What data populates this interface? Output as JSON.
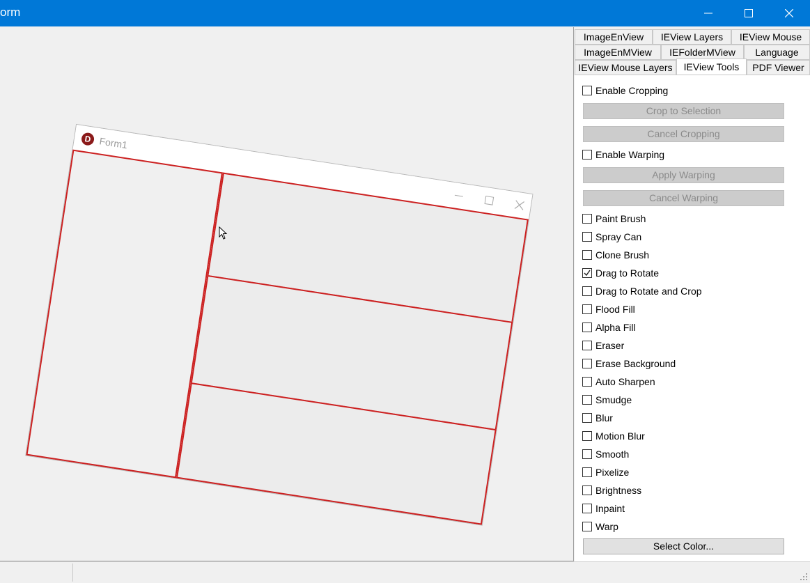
{
  "window": {
    "title": "orm"
  },
  "form_preview": {
    "title": "Form1",
    "icon_letter": "D"
  },
  "tabs": {
    "row1": [
      "ImageEnView",
      "IEView Layers",
      "IEView Mouse"
    ],
    "row2": [
      "ImageEnMView",
      "IEFolderMView",
      "Language"
    ],
    "row3": [
      "IEView Mouse Layers",
      "IEView Tools",
      "PDF Viewer"
    ],
    "active": "IEView Tools"
  },
  "tools": {
    "enable_cropping": {
      "label": "Enable Cropping",
      "checked": false
    },
    "crop_to_selection": "Crop to Selection",
    "cancel_cropping": "Cancel Cropping",
    "enable_warping": {
      "label": "Enable Warping",
      "checked": false
    },
    "apply_warping": "Apply Warping",
    "cancel_warping": "Cancel Warping",
    "options": [
      {
        "label": "Paint Brush",
        "checked": false
      },
      {
        "label": "Spray Can",
        "checked": false
      },
      {
        "label": "Clone Brush",
        "checked": false
      },
      {
        "label": "Drag to Rotate",
        "checked": true
      },
      {
        "label": "Drag to Rotate and Crop",
        "checked": false
      },
      {
        "label": "Flood Fill",
        "checked": false
      },
      {
        "label": "Alpha Fill",
        "checked": false
      },
      {
        "label": "Eraser",
        "checked": false
      },
      {
        "label": "Erase Background",
        "checked": false
      },
      {
        "label": "Auto Sharpen",
        "checked": false
      },
      {
        "label": "Smudge",
        "checked": false
      },
      {
        "label": "Blur",
        "checked": false
      },
      {
        "label": "Motion Blur",
        "checked": false
      },
      {
        "label": "Smooth",
        "checked": false
      },
      {
        "label": "Pixelize",
        "checked": false
      },
      {
        "label": "Brightness",
        "checked": false
      },
      {
        "label": "Inpaint",
        "checked": false
      },
      {
        "label": "Warp",
        "checked": false
      }
    ],
    "select_color": "Select Color..."
  },
  "colors": {
    "titlebar": "#0078d7",
    "panel_border": "#cc2020"
  }
}
